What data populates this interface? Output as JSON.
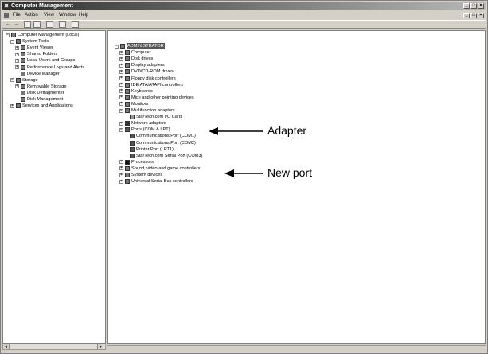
{
  "window": {
    "title": "Computer Management",
    "menus": [
      "File",
      "Action",
      "View",
      "Window",
      "Help"
    ]
  },
  "left_tree": [
    {
      "label": "Computer Management (Local)",
      "level": 0,
      "icon": "computer-management-icon",
      "expander": "minus"
    },
    {
      "label": "System Tools",
      "level": 1,
      "icon": "tools-icon",
      "expander": "minus"
    },
    {
      "label": "Event Viewer",
      "level": 2,
      "icon": "event-viewer-icon",
      "expander": "plus"
    },
    {
      "label": "Shared Folders",
      "level": 2,
      "icon": "folder-icon",
      "expander": "plus"
    },
    {
      "label": "Local Users and Groups",
      "level": 2,
      "icon": "users-icon",
      "expander": "plus"
    },
    {
      "label": "Performance Logs and Alerts",
      "level": 2,
      "icon": "performance-icon",
      "expander": "plus"
    },
    {
      "label": "Device Manager",
      "level": 2,
      "icon": "device-manager-icon",
      "expander": ""
    },
    {
      "label": "Storage",
      "level": 1,
      "icon": "storage-icon",
      "expander": "minus"
    },
    {
      "label": "Removable Storage",
      "level": 2,
      "icon": "removable-storage-icon",
      "expander": "plus"
    },
    {
      "label": "Disk Defragmenter",
      "level": 2,
      "icon": "defrag-icon",
      "expander": ""
    },
    {
      "label": "Disk Management",
      "level": 2,
      "icon": "disk-management-icon",
      "expander": ""
    },
    {
      "label": "Services and Applications",
      "level": 1,
      "icon": "services-icon",
      "expander": "plus"
    }
  ],
  "right_tree": [
    {
      "label": "ADMINISTRATOR",
      "level": 0,
      "icon": "computer-icon",
      "expander": "minus",
      "selected": true
    },
    {
      "label": "Computer",
      "level": 1,
      "icon": "computer-icon",
      "expander": "plus"
    },
    {
      "label": "Disk drives",
      "level": 1,
      "icon": "disk-drive-icon",
      "expander": "plus"
    },
    {
      "label": "Display adapters",
      "level": 1,
      "icon": "display-icon",
      "expander": "plus"
    },
    {
      "label": "DVD/CD-ROM drives",
      "level": 1,
      "icon": "cdrom-icon",
      "expander": "plus"
    },
    {
      "label": "Floppy disk controllers",
      "level": 1,
      "icon": "floppy-icon",
      "expander": "plus"
    },
    {
      "label": "IDE ATA/ATAPI controllers",
      "level": 1,
      "icon": "ide-icon",
      "expander": "plus"
    },
    {
      "label": "Keyboards",
      "level": 1,
      "icon": "keyboard-icon",
      "expander": "plus"
    },
    {
      "label": "Mice and other pointing devices",
      "level": 1,
      "icon": "mouse-icon",
      "expander": "plus"
    },
    {
      "label": "Monitors",
      "level": 1,
      "icon": "monitor-icon",
      "expander": "plus"
    },
    {
      "label": "Multifunction adapters",
      "level": 1,
      "icon": "multifunction-icon",
      "expander": "minus"
    },
    {
      "label": "StarTech.com I/O Card",
      "level": 2,
      "icon": "card-icon",
      "expander": ""
    },
    {
      "label": "Network adapters",
      "level": 1,
      "icon": "network-icon",
      "expander": "plus"
    },
    {
      "label": "Ports (COM & LPT)",
      "level": 1,
      "icon": "port-icon",
      "expander": "minus"
    },
    {
      "label": "Communications Port (COM1)",
      "level": 2,
      "icon": "port-icon",
      "expander": ""
    },
    {
      "label": "Communications Port (COM2)",
      "level": 2,
      "icon": "port-icon",
      "expander": ""
    },
    {
      "label": "Printer Port (LPT1)",
      "level": 2,
      "icon": "port-icon",
      "expander": ""
    },
    {
      "label": "StarTech.com Serial Port (COM3)",
      "level": 2,
      "icon": "port-icon",
      "expander": ""
    },
    {
      "label": "Processors",
      "level": 1,
      "icon": "processor-icon",
      "expander": "plus"
    },
    {
      "label": "Sound, video and game controllers",
      "level": 1,
      "icon": "sound-icon",
      "expander": "plus"
    },
    {
      "label": "System devices",
      "level": 1,
      "icon": "system-icon",
      "expander": "plus"
    },
    {
      "label": "Universal Serial Bus controllers",
      "level": 1,
      "icon": "usb-icon",
      "expander": "plus"
    }
  ],
  "callouts": {
    "adapter": "Adapter",
    "new_port": "New port"
  }
}
